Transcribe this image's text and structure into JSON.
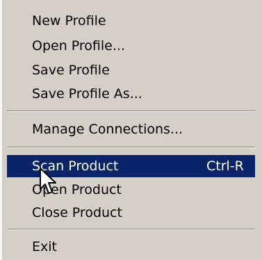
{
  "menu": {
    "items": [
      {
        "label": "New Profile"
      },
      {
        "label": "Open Profile..."
      },
      {
        "label": "Save Profile"
      },
      {
        "label": "Save Profile As..."
      },
      {
        "label": "Manage Connections..."
      },
      {
        "label": "Scan Product",
        "shortcut": "Ctrl-R"
      },
      {
        "label": "Open Product"
      },
      {
        "label": "Close Product"
      },
      {
        "label": "Exit"
      }
    ],
    "highlight_color": "#0a246a",
    "background_color": "#d4d0c8"
  },
  "cursor": {
    "icon": "arrow-pointer-icon"
  }
}
